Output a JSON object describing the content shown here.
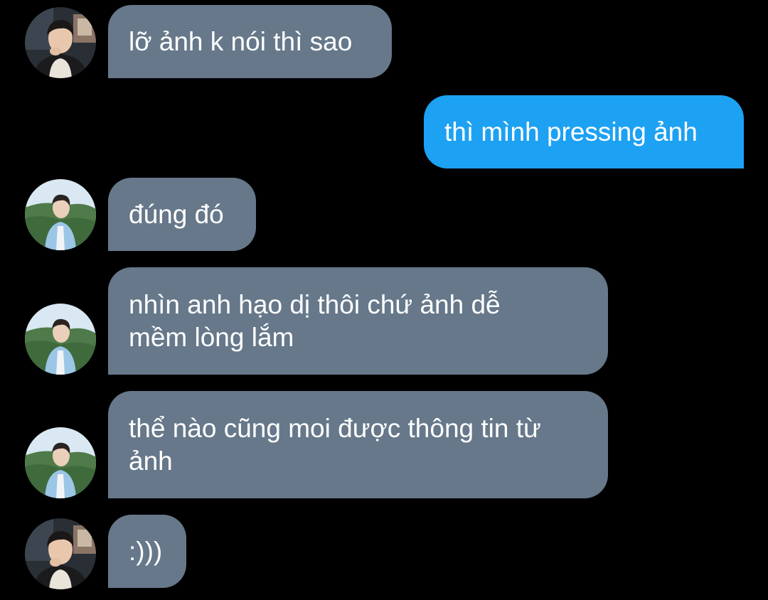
{
  "conversation": {
    "messages": [
      {
        "sender": "contact",
        "avatar": "person-indoor-avatar",
        "lines": [
          "lỡ ảnh k nói thì sao"
        ]
      },
      {
        "sender": "me",
        "lines": [
          "thì mình pressing ảnh"
        ]
      },
      {
        "sender": "contact",
        "avatar": "person-outdoor-avatar",
        "lines": [
          "đúng đó"
        ]
      },
      {
        "sender": "contact",
        "avatar": "person-outdoor-avatar",
        "lines": [
          "nhìn anh hạo dị thôi chứ ảnh dễ",
          "mềm lòng lắm"
        ]
      },
      {
        "sender": "contact",
        "avatar": "person-outdoor-avatar",
        "lines": [
          "thể nào cũng moi được thông tin từ",
          "ảnh"
        ]
      },
      {
        "sender": "contact",
        "avatar": "person-indoor-avatar",
        "lines": [
          ":)))"
        ]
      }
    ]
  },
  "colors": {
    "background": "#000000",
    "incoming_bubble": "#66788a",
    "outgoing_bubble": "#1da1f2",
    "text": "#ffffff"
  }
}
